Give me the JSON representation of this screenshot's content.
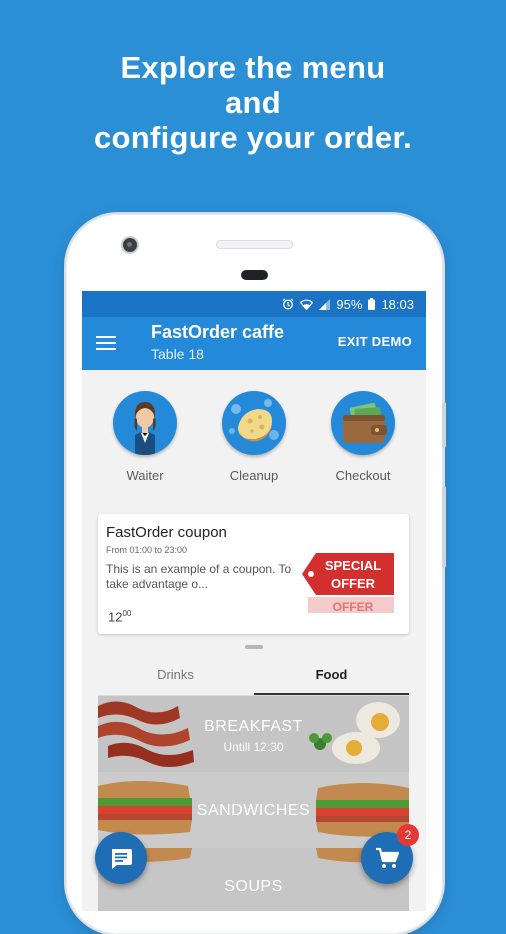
{
  "headline": {
    "line1": "Explore the menu",
    "line2": "and",
    "line3": "configure your order."
  },
  "status_bar": {
    "battery": "95%",
    "time": "18:03"
  },
  "app_bar": {
    "title": "FastOrder caffe",
    "subtitle": "Table 18",
    "exit_label": "EXIT DEMO"
  },
  "actions": [
    {
      "label": "Waiter",
      "icon": "waiter-icon"
    },
    {
      "label": "Cleanup",
      "icon": "sponge-icon"
    },
    {
      "label": "Checkout",
      "icon": "wallet-icon"
    }
  ],
  "coupon": {
    "title": "FastOrder coupon",
    "schedule": "From 01:00 to 23:00",
    "description": "This is an example of a coupon. To take advantage o...",
    "price_main": "12",
    "price_cents": "00",
    "badge_line1": "SPECIAL",
    "badge_line2": "OFFER",
    "badge_line3": "OFFER"
  },
  "tabs": [
    {
      "label": "Drinks",
      "active": false
    },
    {
      "label": "Food",
      "active": true
    }
  ],
  "categories": [
    {
      "label": "BREAKFAST",
      "sub": "Untill 12:30"
    },
    {
      "label": "SANDWICHES",
      "sub": ""
    },
    {
      "label": "SOUPS",
      "sub": ""
    }
  ],
  "cart": {
    "count": "2"
  },
  "colors": {
    "background": "#2b8fd6",
    "primary": "#2389d8",
    "status_bar": "#1a73c4",
    "fab": "#1e6db5",
    "badge": "#e53935"
  }
}
